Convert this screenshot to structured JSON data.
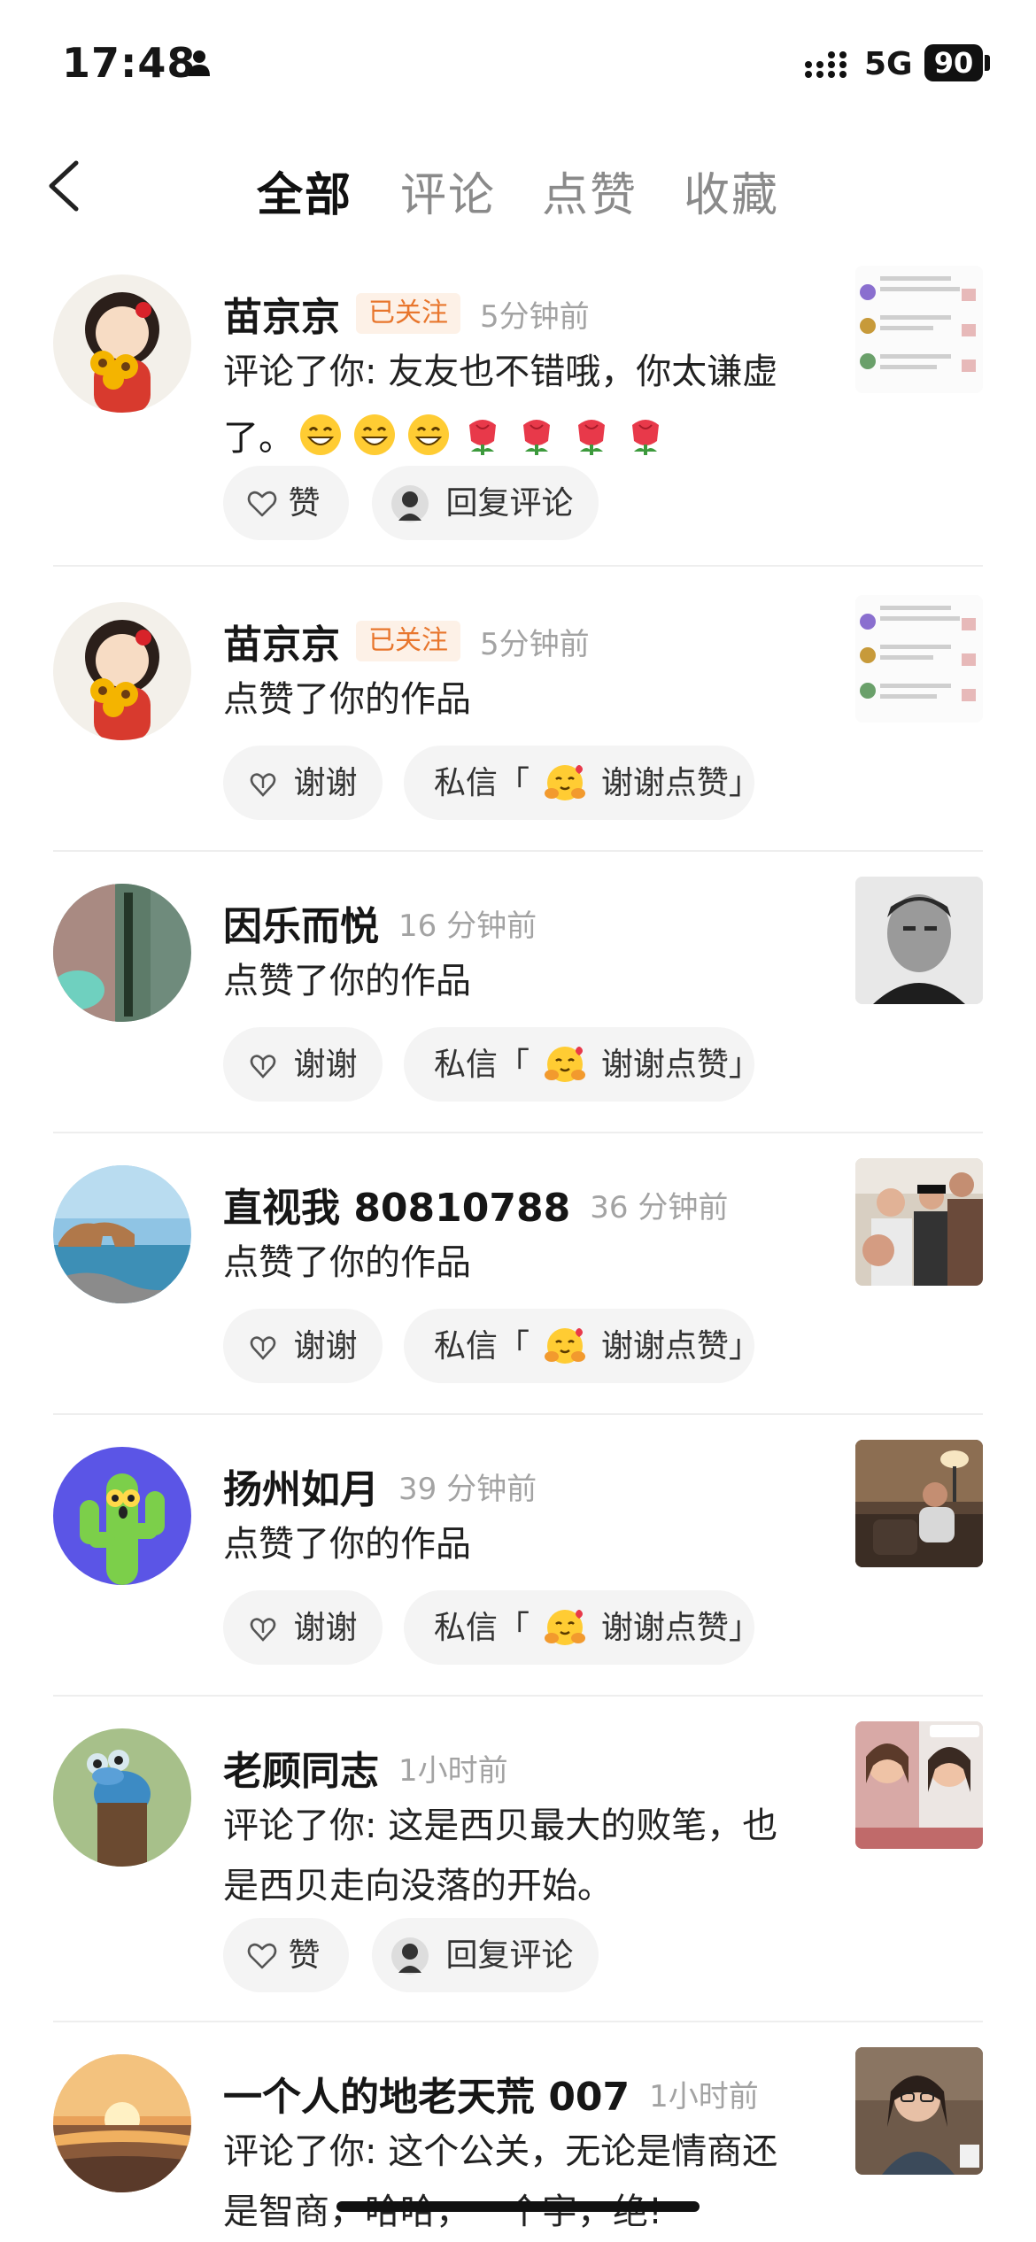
{
  "status_bar": {
    "time": "17:48",
    "network": "5G",
    "battery": "90"
  },
  "tabs": [
    {
      "label": "全部",
      "active": true
    },
    {
      "label": "评论",
      "active": false
    },
    {
      "label": "点赞",
      "active": false
    },
    {
      "label": "收藏",
      "active": false
    }
  ],
  "notifications": [
    {
      "name": "苗京京",
      "badge": "已关注",
      "time": "5分钟前",
      "text_line1": "评论了你: 友友也不错哦，你太谦虚",
      "text_line2": "了。",
      "actions": [
        "赞",
        "回复评论"
      ]
    },
    {
      "name": "苗京京",
      "badge": "已关注",
      "time": "5分钟前",
      "text": "点赞了你的作品",
      "actions": [
        "谢谢",
        "私信「",
        "谢谢点赞」"
      ]
    },
    {
      "name": "因乐而悦",
      "time": "16 分钟前",
      "text": "点赞了你的作品",
      "actions": [
        "谢谢",
        "私信「",
        "谢谢点赞」"
      ]
    },
    {
      "name": "直视我 80810788",
      "time": "36 分钟前",
      "text": "点赞了你的作品",
      "actions": [
        "谢谢",
        "私信「",
        "谢谢点赞」"
      ]
    },
    {
      "name": "扬州如月",
      "time": "39 分钟前",
      "text": "点赞了你的作品",
      "actions": [
        "谢谢",
        "私信「",
        "谢谢点赞」"
      ]
    },
    {
      "name": "老顾同志",
      "time": "1小时前",
      "text_line1": "评论了你: 这是西贝最大的败笔，也",
      "text_line2": "是西贝走向没落的开始。",
      "actions": [
        "赞",
        "回复评论"
      ]
    },
    {
      "name": "一个人的地老天荒 007",
      "time": "1小时前",
      "text_line1": "评论了你: 这个公关，无论是情商还",
      "text_line2": "是智商，哈哈，一个字，绝!"
    }
  ],
  "colors": {
    "accent_orange": "#e8762d",
    "pill_bg": "#f4f4f4",
    "time_gray": "#a3a3a3"
  }
}
